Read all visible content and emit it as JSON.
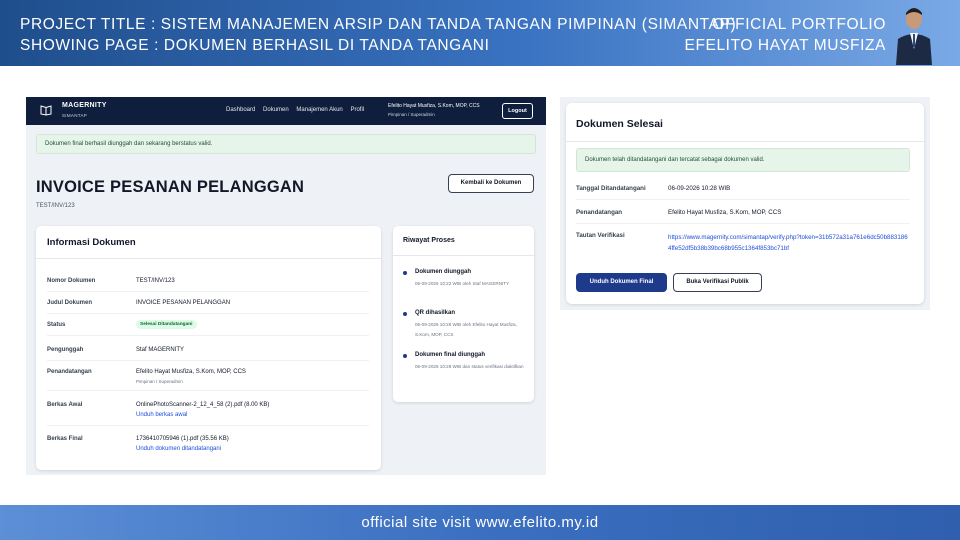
{
  "banner": {
    "project_title": "PROJECT TITLE  : SISTEM MANAJEMEN ARSIP DAN TANDA TANGAN PIMPINAN (SIMANTAP)",
    "showing_page": "SHOWING PAGE : DOKUMEN BERHASIL DI TANDA TANGANI",
    "portfolio": "OFFICIAL PORTFOLIO",
    "author": "EFELITO HAYAT MUSFIZA"
  },
  "footer": {
    "text": "official site visit www.efelito.my.id"
  },
  "app": {
    "nav": {
      "brand": "MAGERNITY",
      "brand_sub": "SIMANTAP",
      "menu": [
        "Dashboard",
        "Dokumen",
        "Manajemen Akun",
        "Profil"
      ],
      "user_name": "Efelito Hayat Musfiza, S.Kom, MOP, CCS",
      "user_role": "Pimpinan / Superadmin",
      "logout": "Logout"
    },
    "alert": "Dokumen final berhasil diunggah dan sekarang berstatus valid.",
    "title": "INVOICE PESANAN PELANGGAN",
    "subtitle": "TEST/INV/123",
    "back_button": "Kembali ke Dokumen",
    "info": {
      "header": "Informasi Dokumen",
      "nomor_label": "Nomor Dokumen",
      "nomor_value": "TEST/INV/123",
      "judul_label": "Judul Dokumen",
      "judul_value": "INVOICE PESANAN PELANGGAN",
      "status_label": "Status",
      "status_value": "Selesai Ditandatangani",
      "pengunggah_label": "Pengunggah",
      "pengunggah_value": "Staf MAGERNITY",
      "penandatangan_label": "Penandatangan",
      "penandatangan_value": "Efelito Hayat Musfiza, S.Kom, MOP, CCS",
      "penandatangan_role": "Pimpinan / Superadmin",
      "berkas_awal_label": "Berkas Awal",
      "berkas_awal_value": "OnlinePhotoScanner-2_12_4_58 (2).pdf (8.00 KB)",
      "berkas_awal_link": "Unduh berkas awal",
      "berkas_final_label": "Berkas Final",
      "berkas_final_value": "1736410705946 (1).pdf (35.56 KB)",
      "berkas_final_link": "Unduh dokumen ditandatangani"
    },
    "history": {
      "header": "Riwayat Proses",
      "events": [
        {
          "title": "Dokumen diunggah",
          "desc": "06-09-2026 10:22 WIB oleh Staf MAGERNITY"
        },
        {
          "title": "QR dihasilkan",
          "desc": "06-09-2026 10:26 WIB oleh Efelito Hayat Musfiza, S.Kom, MOP, CCS"
        },
        {
          "title": "Dokumen final diunggah",
          "desc": "06-09-2026 10:28 WIB dan status verifikasi diaktifkan"
        }
      ]
    }
  },
  "done": {
    "header": "Dokumen Selesai",
    "alert": "Dokumen telah ditandatangani dan tercatat sebagai dokumen valid.",
    "tanggal_label": "Tanggal Ditandatangani",
    "tanggal_value": "06-09-2026 10:28 WIB",
    "penandatangan_label": "Penandatangan",
    "penandatangan_value": "Efelito Hayat Musfiza, S.Kom, MOP, CCS",
    "tautan_label": "Tautan Verifikasi",
    "tautan_value": "https://www.magernity.com/simantap/verify.php?token=31b572a31a761e6dc50b8831864ffe52df5b38b39bc68b955c1364f853bc71bf",
    "btn_unduh": "Unduh Dokumen Final",
    "btn_buka": "Buka Verifikasi Publik"
  }
}
